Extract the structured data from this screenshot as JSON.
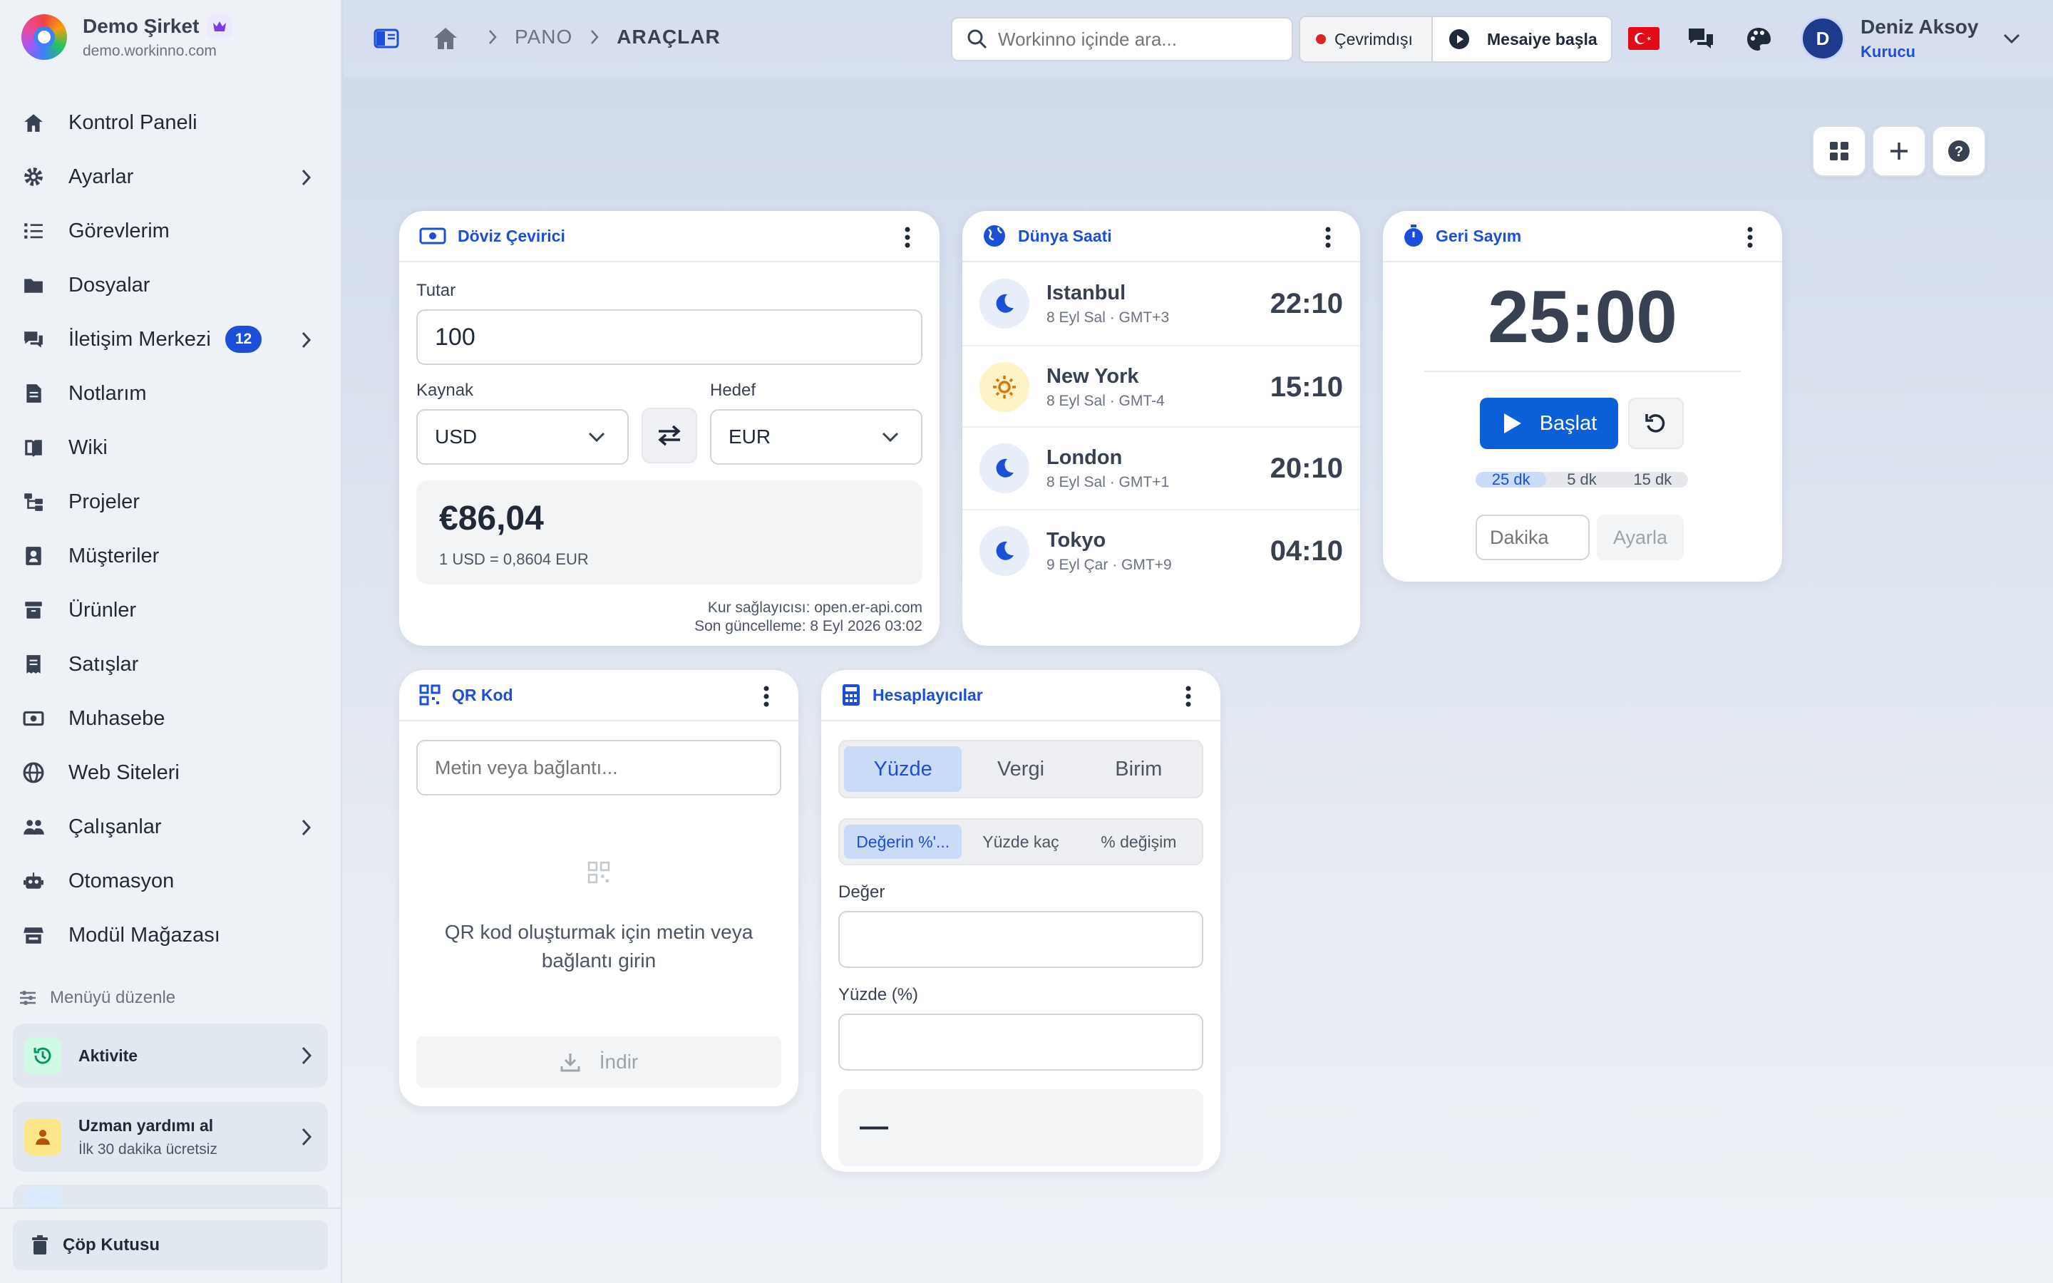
{
  "brand": {
    "name": "Demo Şirket",
    "domain": "demo.workinno.com"
  },
  "sidebar": {
    "items": [
      {
        "label": "Kontrol Paneli",
        "icon": "home-icon"
      },
      {
        "label": "Ayarlar",
        "icon": "gear-icon",
        "chevron": true
      },
      {
        "label": "Görevlerim",
        "icon": "checklist-icon"
      },
      {
        "label": "Dosyalar",
        "icon": "folder-icon"
      },
      {
        "label": "İletişim Merkezi",
        "icon": "chat-icon",
        "badge": "12",
        "chevron": true
      },
      {
        "label": "Notlarım",
        "icon": "note-icon"
      },
      {
        "label": "Wiki",
        "icon": "book-icon"
      },
      {
        "label": "Projeler",
        "icon": "project-icon"
      },
      {
        "label": "Müşteriler",
        "icon": "contact-icon"
      },
      {
        "label": "Ürünler",
        "icon": "archive-icon"
      },
      {
        "label": "Satışlar",
        "icon": "receipt-icon"
      },
      {
        "label": "Muhasebe",
        "icon": "money-icon"
      },
      {
        "label": "Web Siteleri",
        "icon": "globe-icon"
      },
      {
        "label": "Çalışanlar",
        "icon": "users-icon",
        "chevron": true
      },
      {
        "label": "Otomasyon",
        "icon": "robot-icon"
      },
      {
        "label": "Modül Mağazası",
        "icon": "store-icon"
      }
    ],
    "menu_edit": "Menüyü düzenle",
    "activity": "Aktivite",
    "expert_title": "Uzman yardımı al",
    "expert_sub": "İlk 30 dakika ücretsiz",
    "trash": "Çöp Kutusu"
  },
  "header": {
    "breadcrumb": [
      "PANO",
      "ARAÇLAR"
    ],
    "search_placeholder": "Workinno içinde ara...",
    "status": "Çevrimdışı",
    "shift": "Mesaiye başla",
    "user_name": "Deniz Aksoy",
    "user_role": "Kurucu",
    "user_initial": "D"
  },
  "currency": {
    "title": "Döviz Çevirici",
    "amount_label": "Tutar",
    "amount": "100",
    "source_label": "Kaynak",
    "source": "USD",
    "target_label": "Hedef",
    "target": "EUR",
    "result": "€86,04",
    "rate": "1 USD = 0,8604 EUR",
    "provider": "Kur sağlayıcısı: open.er-api.com",
    "updated": "Son güncelleme: 8 Eyl 2026 03:02"
  },
  "world_clock": {
    "title": "Dünya Saati",
    "rows": [
      {
        "city": "Istanbul",
        "detail": "8 Eyl Sal · GMT+3",
        "time": "22:10",
        "icon": "moon-icon"
      },
      {
        "city": "New York",
        "detail": "8 Eyl Sal · GMT-4",
        "time": "15:10",
        "icon": "sun-icon"
      },
      {
        "city": "London",
        "detail": "8 Eyl Sal · GMT+1",
        "time": "20:10",
        "icon": "moon-icon"
      },
      {
        "city": "Tokyo",
        "detail": "9 Eyl Çar · GMT+9",
        "time": "04:10",
        "icon": "moon-icon"
      }
    ]
  },
  "countdown": {
    "title": "Geri Sayım",
    "time": "25:00",
    "start": "Başlat",
    "presets": [
      "25 dk",
      "5 dk",
      "15 dk"
    ],
    "minute_placeholder": "Dakika",
    "set": "Ayarla"
  },
  "qr": {
    "title": "QR Kod",
    "placeholder": "Metin veya bağlantı...",
    "hint": "QR kod oluşturmak için metin veya bağlantı girin",
    "download": "İndir"
  },
  "calc": {
    "title": "Hesaplayıcılar",
    "tabs": [
      "Yüzde",
      "Vergi",
      "Birim"
    ],
    "subtabs": [
      "Değerin %'...",
      "Yüzde kaç",
      "% değişim"
    ],
    "value_label": "Değer",
    "percent_label": "Yüzde (%)",
    "result": "—"
  }
}
